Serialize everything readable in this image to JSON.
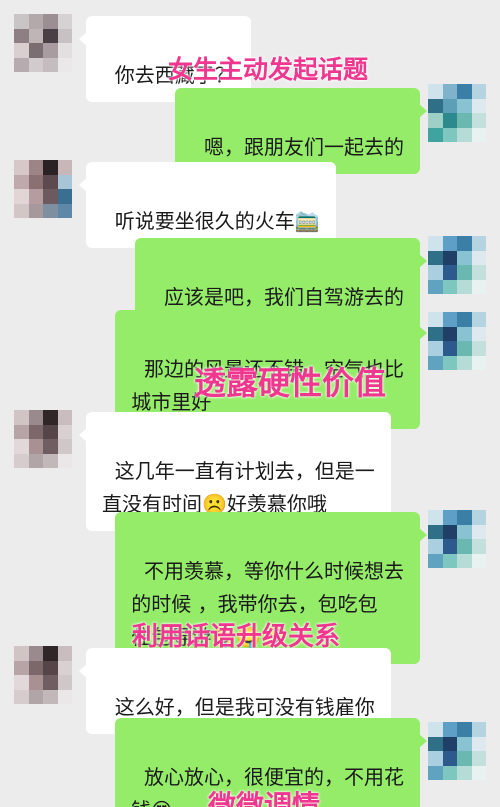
{
  "messages": [
    {
      "side": "left",
      "text": "你去西藏了？",
      "emoji": ""
    },
    {
      "side": "right",
      "text": "嗯，跟朋友们一起去的",
      "emoji": ""
    },
    {
      "side": "left",
      "text": "听说要坐很久的火车",
      "emoji": "🚞"
    },
    {
      "side": "right",
      "text": "应该是吧，我们自驾游去的",
      "emoji": ""
    },
    {
      "side": "right",
      "text": "那边的风景还不错，空气也比\n城市里好",
      "emoji": ""
    },
    {
      "side": "left",
      "text": "这几年一直有计划去，但是一\n直没有时间",
      "emoji": "☹️好羡慕你哦"
    },
    {
      "side": "right",
      "text": "不用羡慕，等你什么时候想去\n的时候 ，我带你去，包吃包\n住包导游",
      "emoji": "🤤🤤🤤"
    },
    {
      "side": "left",
      "text": "这么好，但是我可没有钱雇你",
      "emoji": ""
    },
    {
      "side": "right",
      "text": "放心放心，很便宜的，不用花\n钱",
      "emoji": "😍"
    }
  ],
  "annotations": [
    "女生主动发起话题",
    "透露硬性价值",
    "利用话语升级关系",
    "微微调情"
  ],
  "colors": {
    "background": "#ececec",
    "bubble_left": "#ffffff",
    "bubble_right": "#95ec69",
    "annotation": "#f0378f"
  }
}
